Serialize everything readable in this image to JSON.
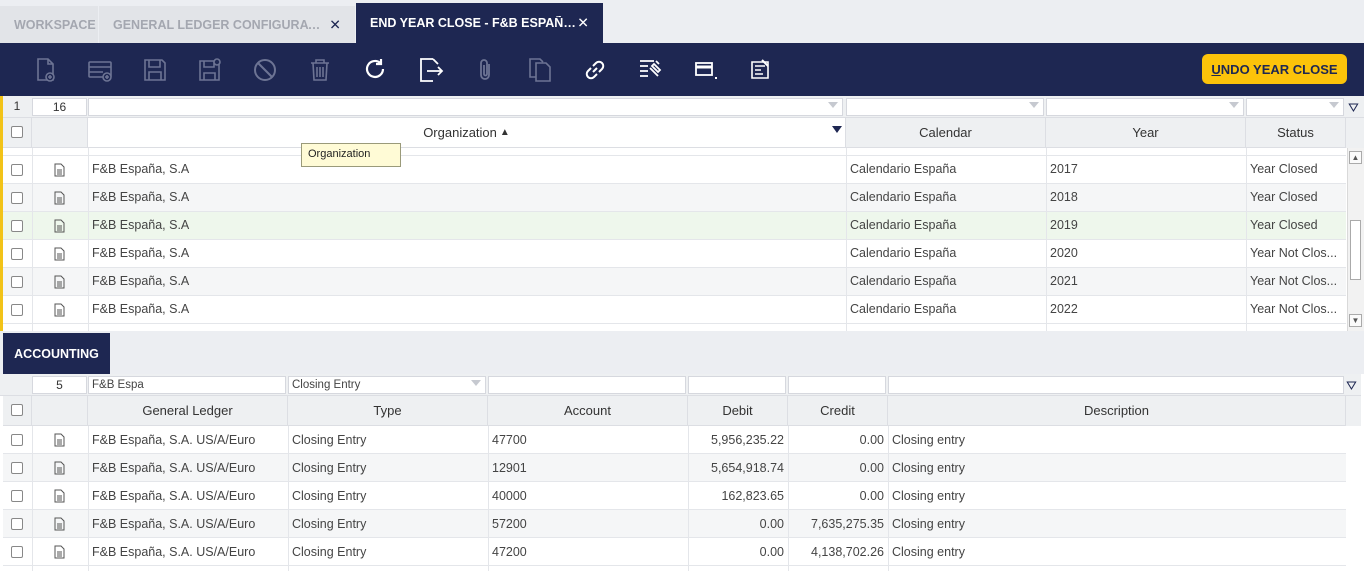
{
  "tabs": [
    {
      "label": "WORKSPACE",
      "closable": false
    },
    {
      "label": "GENERAL LEDGER CONFIGURATION ...",
      "closable": true
    },
    {
      "label": "END YEAR CLOSE - F&B ESPAÑA, S...",
      "closable": true,
      "active": true
    }
  ],
  "toolbar": {
    "icons": [
      "new-document-icon",
      "new-row-icon",
      "save-icon",
      "save-close-icon",
      "cancel-icon",
      "delete-icon",
      "refresh-icon",
      "export-icon",
      "attach-icon",
      "copy-record-icon",
      "link-icon",
      "audit-icon",
      "toggle-view-icon",
      "filter-edit-icon"
    ],
    "undo_label": "UNDO YEAR CLOSE",
    "undo_mnemonic": "U",
    "undo_rest": "NDO YEAR CLOSE"
  },
  "upper_grid": {
    "page": "1",
    "count": "16",
    "columns": [
      "Organization",
      "Calendar",
      "Year",
      "Status"
    ],
    "sort_indicator": "▲",
    "tooltip": "Organization",
    "rows": [
      {
        "organization": "F&B España, S.A",
        "calendar": "Calendario España",
        "year": "2017",
        "status": "Year Closed"
      },
      {
        "organization": "F&B España, S.A",
        "calendar": "Calendario España",
        "year": "2018",
        "status": "Year Closed"
      },
      {
        "organization": "F&B España, S.A",
        "calendar": "Calendario España",
        "year": "2019",
        "status": "Year Closed"
      },
      {
        "organization": "F&B España, S.A",
        "calendar": "Calendario España",
        "year": "2020",
        "status": "Year Not Clos..."
      },
      {
        "organization": "F&B España, S.A",
        "calendar": "Calendario España",
        "year": "2021",
        "status": "Year Not Clos..."
      },
      {
        "organization": "F&B España, S.A",
        "calendar": "Calendario España",
        "year": "2022",
        "status": "Year Not Clos..."
      }
    ]
  },
  "accounting": {
    "section_label": "ACCOUNTING",
    "count": "5",
    "filters": {
      "general_ledger": "F&B Espa",
      "type": "Closing Entry"
    },
    "columns": [
      "General Ledger",
      "Type",
      "Account",
      "Debit",
      "Credit",
      "Description"
    ],
    "rows": [
      {
        "general_ledger": "F&B España, S.A. US/A/Euro",
        "type": "Closing Entry",
        "account": "47700",
        "debit": "5,956,235.22",
        "credit": "0.00",
        "description": "Closing entry"
      },
      {
        "general_ledger": "F&B España, S.A. US/A/Euro",
        "type": "Closing Entry",
        "account": "12901",
        "debit": "5,654,918.74",
        "credit": "0.00",
        "description": "Closing entry"
      },
      {
        "general_ledger": "F&B España, S.A. US/A/Euro",
        "type": "Closing Entry",
        "account": "40000",
        "debit": "162,823.65",
        "credit": "0.00",
        "description": "Closing entry"
      },
      {
        "general_ledger": "F&B España, S.A. US/A/Euro",
        "type": "Closing Entry",
        "account": "57200",
        "debit": "0.00",
        "credit": "7,635,275.35",
        "description": "Closing entry"
      },
      {
        "general_ledger": "F&B España, S.A. US/A/Euro",
        "type": "Closing Entry",
        "account": "47200",
        "debit": "0.00",
        "credit": "4,138,702.26",
        "description": "Closing entry"
      }
    ]
  }
}
